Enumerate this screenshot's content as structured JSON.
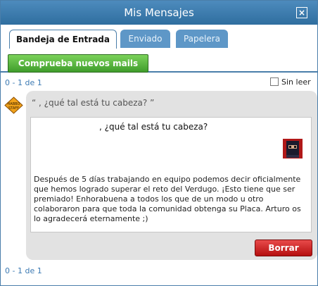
{
  "window": {
    "title": "Mis Mensajes",
    "close_label": "×"
  },
  "tabs": [
    {
      "label": "Bandeja de Entrada",
      "active": true
    },
    {
      "label": "Enviado",
      "active": false
    },
    {
      "label": "Papelera",
      "active": false
    }
  ],
  "check_button": {
    "label": "Comprueba nuevos mails"
  },
  "pager": {
    "top": "0 - 1 de 1",
    "bottom": "0 - 1 de 1"
  },
  "unread_filter": {
    "label": "Sin leer",
    "checked": false
  },
  "message": {
    "subject_preview": "“                    , ¿qué tal está tu cabeza? ”",
    "heading": ", ¿qué tal está tu cabeza?",
    "body": "Después de 5 días trabajando en equipo podemos decir oficialmente que hemos logrado superar el reto del Verdugo. ¡Esto tiene que ser premiado! Enhorabuena a todos los que de un modo u otro colaboraron para que toda la comunidad obtenga su Placa. Arturo os lo agradecerá eternamente ;)",
    "delete_label": "Borrar",
    "sender_badge": "staff-badge-icon",
    "attachment_icon": "ninja-avatar-icon"
  },
  "colors": {
    "titlebar": "#3a77a8",
    "delete": "#c81b1b",
    "check": "#4caf36"
  }
}
